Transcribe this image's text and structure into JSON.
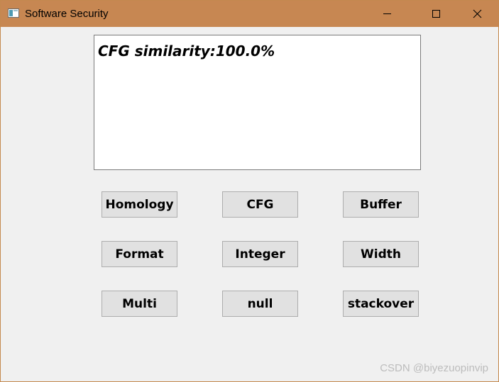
{
  "window": {
    "title": "Software Security"
  },
  "output": {
    "text": "CFG similarity:100.0%"
  },
  "buttons": [
    {
      "label": "Homology"
    },
    {
      "label": "CFG"
    },
    {
      "label": "Buffer"
    },
    {
      "label": "Format"
    },
    {
      "label": "Integer"
    },
    {
      "label": "Width"
    },
    {
      "label": "Multi"
    },
    {
      "label": "null"
    },
    {
      "label": "stackover"
    }
  ],
  "watermark": {
    "text": "CSDN @biyezuopinvip"
  },
  "colors": {
    "titlebar": "#c78752",
    "window_bg": "#f0f0f0",
    "button_bg": "#e1e1e1",
    "button_border": "#adadad"
  },
  "icons": {
    "app": "app-window-icon",
    "minimize": "minimize-icon",
    "maximize": "maximize-icon",
    "close": "close-icon"
  }
}
